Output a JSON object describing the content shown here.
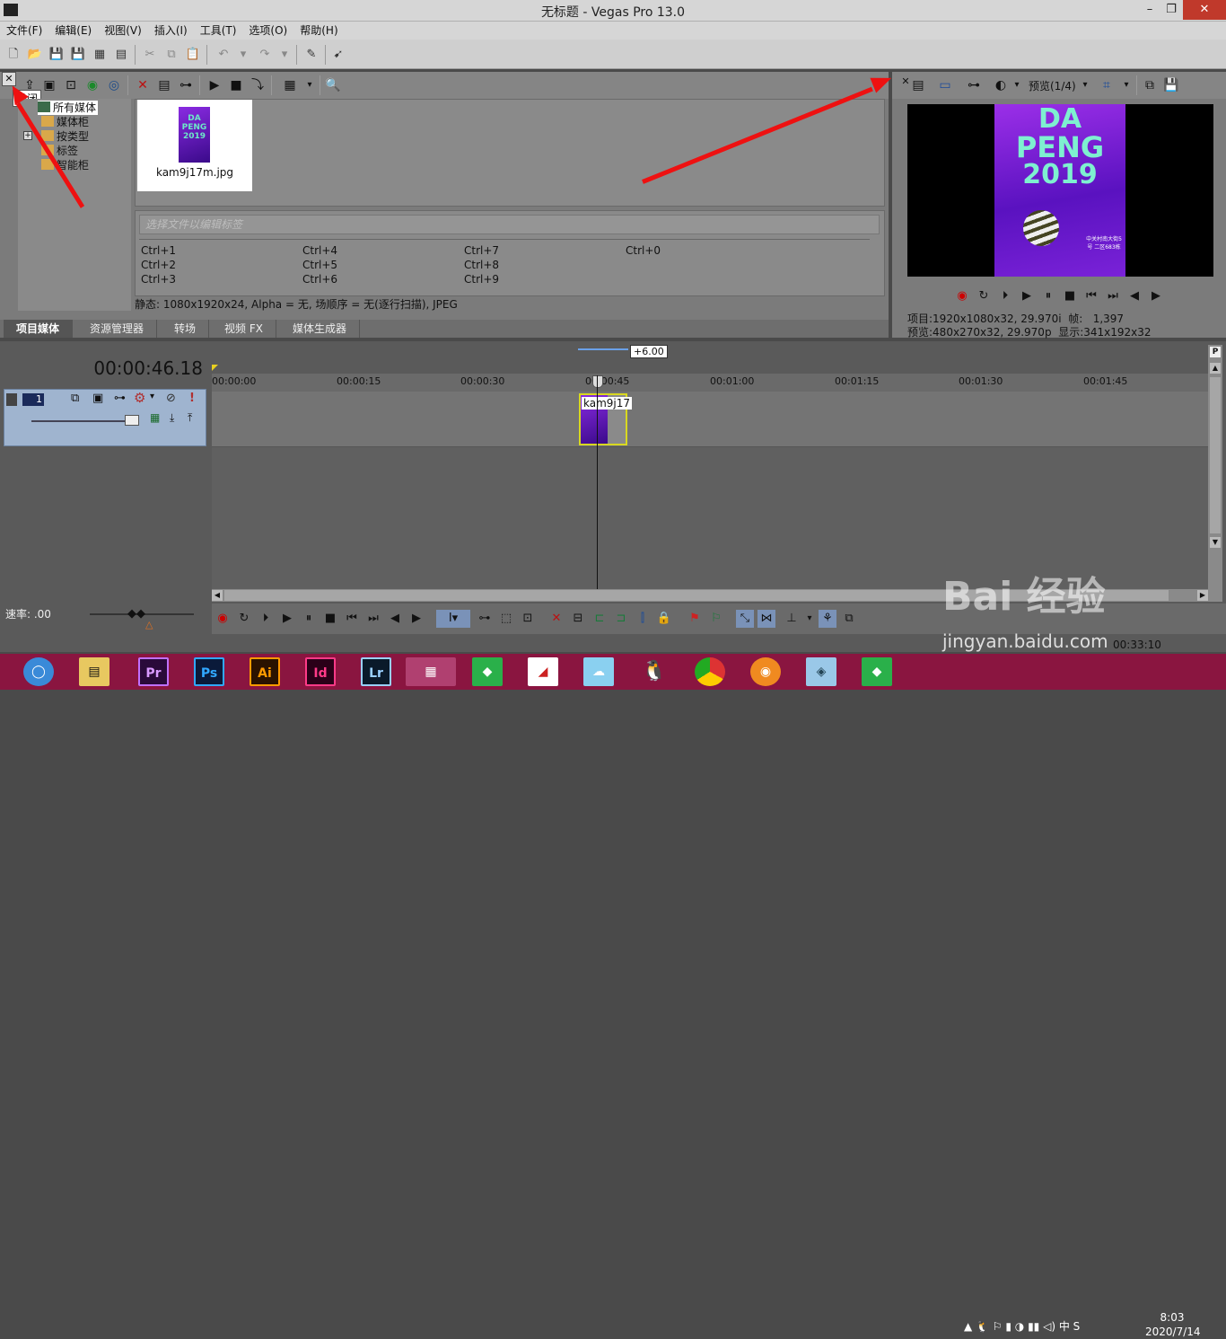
{
  "window": {
    "title": "无标题 - Vegas Pro 13.0",
    "min": "–",
    "max": "❐",
    "close": "✕"
  },
  "menu": [
    "文件(F)",
    "编辑(E)",
    "视图(V)",
    "插入(I)",
    "工具(T)",
    "选项(O)",
    "帮助(H)"
  ],
  "media": {
    "close_tooltip": "关闭",
    "tree": [
      "所有媒体",
      "媒体柜",
      "按类型",
      "标签",
      "智能柜"
    ],
    "tree_expand": "+",
    "file_name": "kam9j17m.jpg",
    "poster_text": "DA PENG 2019",
    "tag_placeholder": "选择文件以编辑标签",
    "shortcuts": [
      "Ctrl+1",
      "Ctrl+4",
      "Ctrl+7",
      "Ctrl+0",
      "Ctrl+2",
      "Ctrl+5",
      "Ctrl+8",
      "Ctrl+3",
      "Ctrl+6",
      "Ctrl+9"
    ],
    "status": "静态: 1080x1920x24, Alpha = 无, 场顺序 = 无(逐行扫描), JPEG"
  },
  "tabs": [
    "项目媒体",
    "资源管理器",
    "转场",
    "视频 FX",
    "媒体生成器"
  ],
  "preview": {
    "quality": "预览(1/4)",
    "poster_line1": "DA",
    "poster_line2": "PENG",
    "poster_line3": "2019",
    "poster_info": "中关村南大街5号 二区683栋",
    "project_label": "项目:",
    "project_value": "1920x1080x32, 29.970i",
    "frame_label": "帧:",
    "frame_value": "1,397",
    "preview_label": "预览:",
    "preview_value": "480x270x32, 29.970p",
    "display_label": "显示:",
    "display_value": "341x192x32"
  },
  "timeline": {
    "timecode": "00:00:46.18",
    "offset": "+6.00",
    "track_number": "1",
    "ticks": [
      "00:00:00",
      "00:00:15",
      "00:00:30",
      "00:00:45",
      "00:01:00",
      "00:01:15",
      "00:01:30",
      "00:01:45"
    ],
    "clip_label": "kam9j17",
    "rate": "速率: .00",
    "end_time": "00:33:10"
  },
  "taskbar": {
    "apps": [
      "Pr",
      "Ps",
      "Ai",
      "Id",
      "Lr"
    ],
    "time": "8:03",
    "date": "2020/7/14"
  },
  "watermark": {
    "brand": "Bai 经验",
    "url": "jingyan.baidu.com"
  },
  "colors": {
    "accent": "#ee1111",
    "taskbar": "#8a1540"
  }
}
